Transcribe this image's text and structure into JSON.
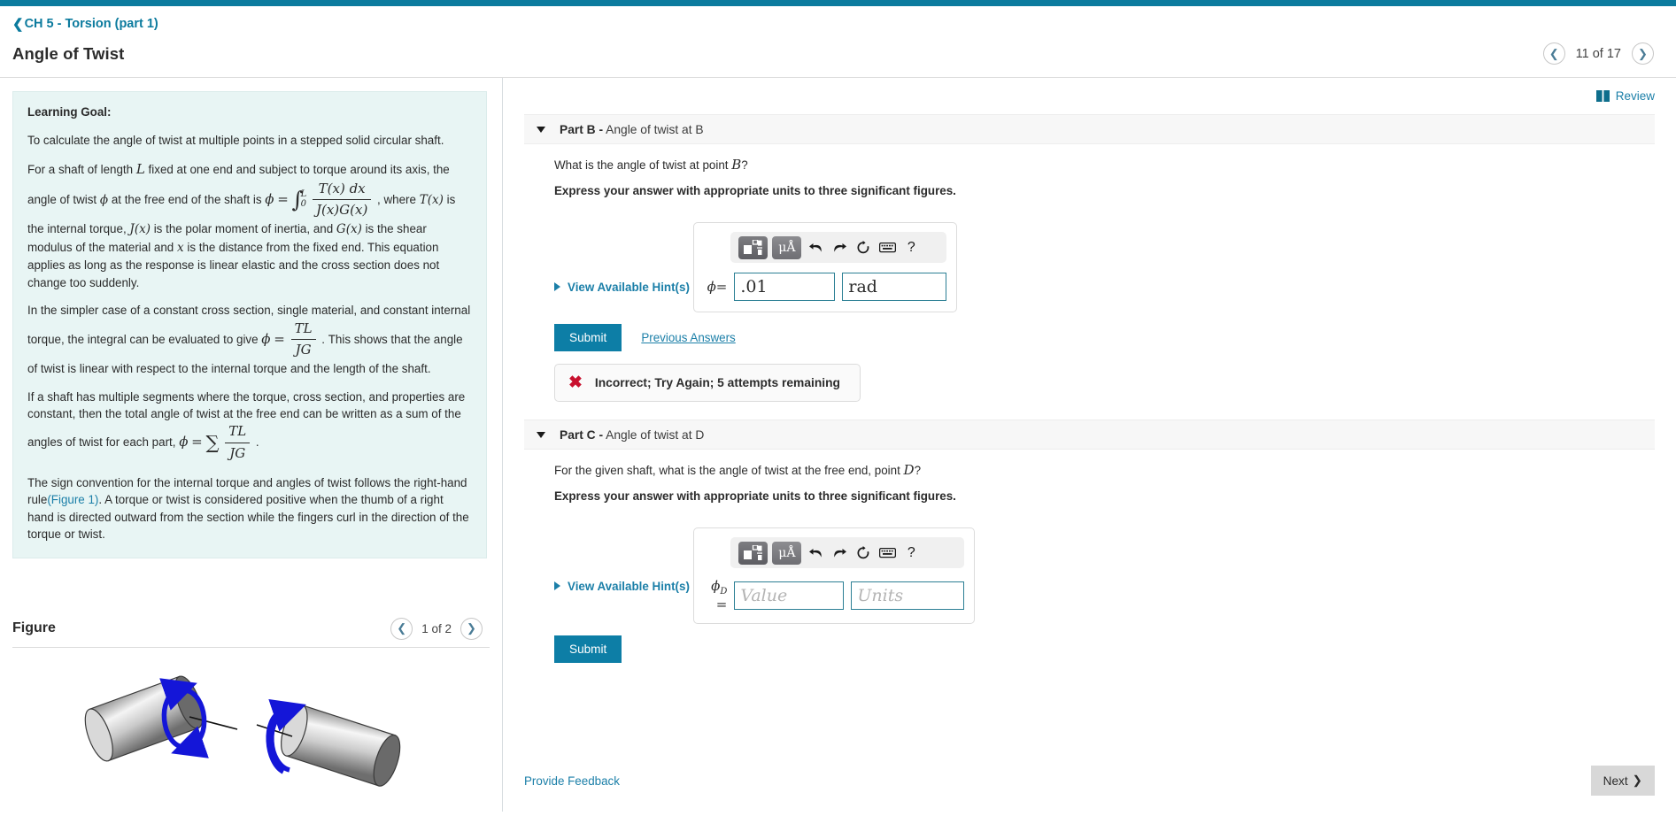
{
  "topbar": {
    "accent_color": "#0c7b9e"
  },
  "header": {
    "breadcrumb": "CH 5 - Torsion (part 1)",
    "title": "Angle of Twist",
    "pager": {
      "prev_icon": "chevron-left-icon",
      "label": "11 of 17",
      "next_icon": "chevron-right-icon"
    }
  },
  "review": {
    "label": "Review",
    "icon": "book-icon",
    "color": "#1b7fa8"
  },
  "learning_goal": {
    "heading": "Learning Goal:",
    "p1": "To calculate the angle of twist at multiple points in a stepped solid circular shaft.",
    "p2_a": "For a shaft of length",
    "p2_L": "L",
    "p2_b": "fixed at one end and subject to torque around its axis, the angle of twist",
    "p2_phi": "ϕ",
    "p2_c": "at the free end of the shaft is",
    "p2_phi2": "ϕ",
    "p2_eq": "=",
    "p2_int_upper": "L",
    "p2_int_lower": "0",
    "p2_num": "T(x) dx",
    "p2_den": "J(x)G(x)",
    "p2_d": ", where",
    "p2_T": "T(x)",
    "p2_e": "is the internal torque,",
    "p2_J": "J(x)",
    "p2_f": "is the polar moment of inertia, and",
    "p2_G": "G(x)",
    "p2_g": "is the shear modulus of the material and",
    "p2_x": "x",
    "p2_h": "is the distance from the fixed end. This equation applies as long as the response is linear elastic and the cross section does not change too suddenly.",
    "p3_a": "In the simpler case of a constant cross section, single material, and constant internal torque, the integral can be evaluated to give",
    "p3_phi": "ϕ",
    "p3_eq": "=",
    "p3_num": "TL",
    "p3_den": "JG",
    "p3_b": ". This shows that the angle of twist is linear with respect to the internal torque and the length of the shaft.",
    "p4_a": "If a shaft has multiple segments where the torque, cross section, and properties are constant, then the total angle of twist at the free end can be written as a sum of the angles of twist for each part,",
    "p4_phi": "ϕ",
    "p4_eq": "=",
    "p4_sum": "∑",
    "p4_num": "TL",
    "p4_den": "JG",
    "p4_b": ".",
    "p5_a": "The sign convention for the internal torque and angles of twist follows the right-hand rule",
    "p5_link": "(Figure 1)",
    "p5_b": ". A torque or twist is considered positive when the thumb of a right hand is directed outward from the section while the fingers curl in the direction of the torque or twist."
  },
  "figure": {
    "title": "Figure",
    "pager": {
      "prev_icon": "chevron-left-icon",
      "label": "1 of 2",
      "next_icon": "chevron-right-icon"
    },
    "description": "Two gray shaded cylinders with blue circular torque arrows and black axis lines illustrating the right-hand rule sign convention",
    "arrow_color": "#1416d8"
  },
  "parts": [
    {
      "id": "part-b",
      "name": "Part B",
      "separator": "-",
      "description": "Angle of twist at B",
      "question_a": "What is the angle of twist at point",
      "question_var": "B",
      "question_b": "?",
      "instruction": "Express your answer with appropriate units to three significant figures.",
      "hints_label": "View Available Hint(s)",
      "toolbar": [
        "template-icon",
        "units-mu-angstrom-icon",
        "undo-icon",
        "redo-icon",
        "reset-icon",
        "keyboard-icon",
        "help-icon"
      ],
      "units_button_label": "μÅ",
      "help_label": "?",
      "var_label": "ϕ",
      "var_sub": "",
      "equals": "=",
      "value": ".01",
      "value_placeholder": "Value",
      "units": "rad",
      "units_placeholder": "Units",
      "submit_label": "Submit",
      "previous_answers_label": "Previous Answers",
      "feedback": {
        "icon": "x-mark-icon",
        "text": "Incorrect; Try Again; 5 attempts remaining",
        "color": "#c8102e"
      }
    },
    {
      "id": "part-c",
      "name": "Part C",
      "separator": "-",
      "description": "Angle of twist at D",
      "question_a": "For the given shaft, what is the angle of twist at the free end, point",
      "question_var": "D",
      "question_b": "?",
      "instruction": "Express your answer with appropriate units to three significant figures.",
      "hints_label": "View Available Hint(s)",
      "toolbar": [
        "template-icon",
        "units-mu-angstrom-icon",
        "undo-icon",
        "redo-icon",
        "reset-icon",
        "keyboard-icon",
        "help-icon"
      ],
      "units_button_label": "μÅ",
      "help_label": "?",
      "var_label": "ϕ",
      "var_sub": "D",
      "equals": "=",
      "value": "",
      "value_placeholder": "Value",
      "units": "",
      "units_placeholder": "Units",
      "submit_label": "Submit"
    }
  ],
  "footer": {
    "feedback_link": "Provide Feedback",
    "next_label": "Next",
    "next_icon": "chevron-right-icon"
  }
}
